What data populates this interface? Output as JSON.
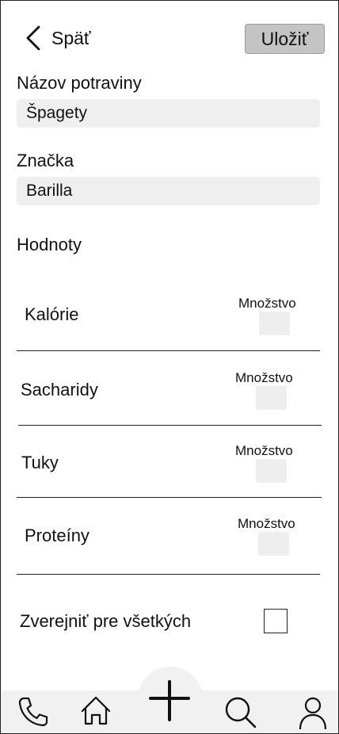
{
  "header": {
    "back_label": "Späť",
    "save_label": "Uložiť"
  },
  "form": {
    "food_name": {
      "label": "Názov potraviny",
      "value": "Špagety"
    },
    "brand": {
      "label": "Značka",
      "value": "Barilla"
    }
  },
  "values_section": {
    "title": "Hodnoty",
    "rows": [
      {
        "label": "Kalórie",
        "quantity_label": "Množstvo"
      },
      {
        "label": "Sacharidy",
        "quantity_label": "Množstvo"
      },
      {
        "label": "Tuky",
        "quantity_label": "Množstvo"
      },
      {
        "label": "Proteíny",
        "quantity_label": "Množstvo"
      }
    ]
  },
  "publish": {
    "label": "Zverejniť pre všetkých",
    "checked": false
  },
  "bottom_nav": {
    "items": [
      {
        "icon": "phone-icon"
      },
      {
        "icon": "home-icon"
      },
      {
        "icon": "plus-icon"
      },
      {
        "icon": "search-icon"
      },
      {
        "icon": "user-icon"
      }
    ]
  },
  "colors": {
    "save_button_bg": "#c4c4c4",
    "field_bg": "#efefef",
    "nav_bg": "#f1f1f1"
  }
}
